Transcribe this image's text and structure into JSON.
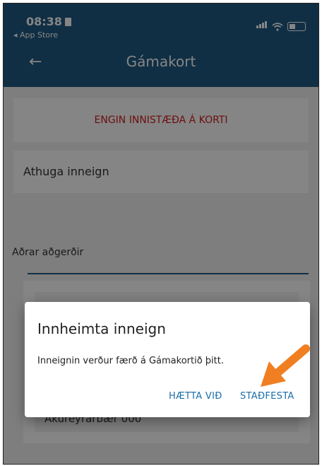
{
  "status_bar": {
    "time": "08:38",
    "back_app": "◂ App Store"
  },
  "nav": {
    "back_glyph": "←",
    "title": "Gámakort"
  },
  "content": {
    "warning": "ENGIN INNISTÆÐA Á KORTI",
    "check_balance": "Athuga inneign",
    "section_label": "Aðrar aðgerðir",
    "list_rows": [
      "",
      "",
      "Akureyrarbær 000"
    ]
  },
  "dialog": {
    "title": "Innheimta inneign",
    "message": "Inneignin verður færð á Gámakortið þitt.",
    "cancel": "HÆTTA VIÐ",
    "confirm": "STAÐFESTA"
  },
  "colors": {
    "header": "#1f5a84",
    "warning": "#d21b1b",
    "button": "#1b6ea8",
    "arrow": "#f07f22"
  }
}
